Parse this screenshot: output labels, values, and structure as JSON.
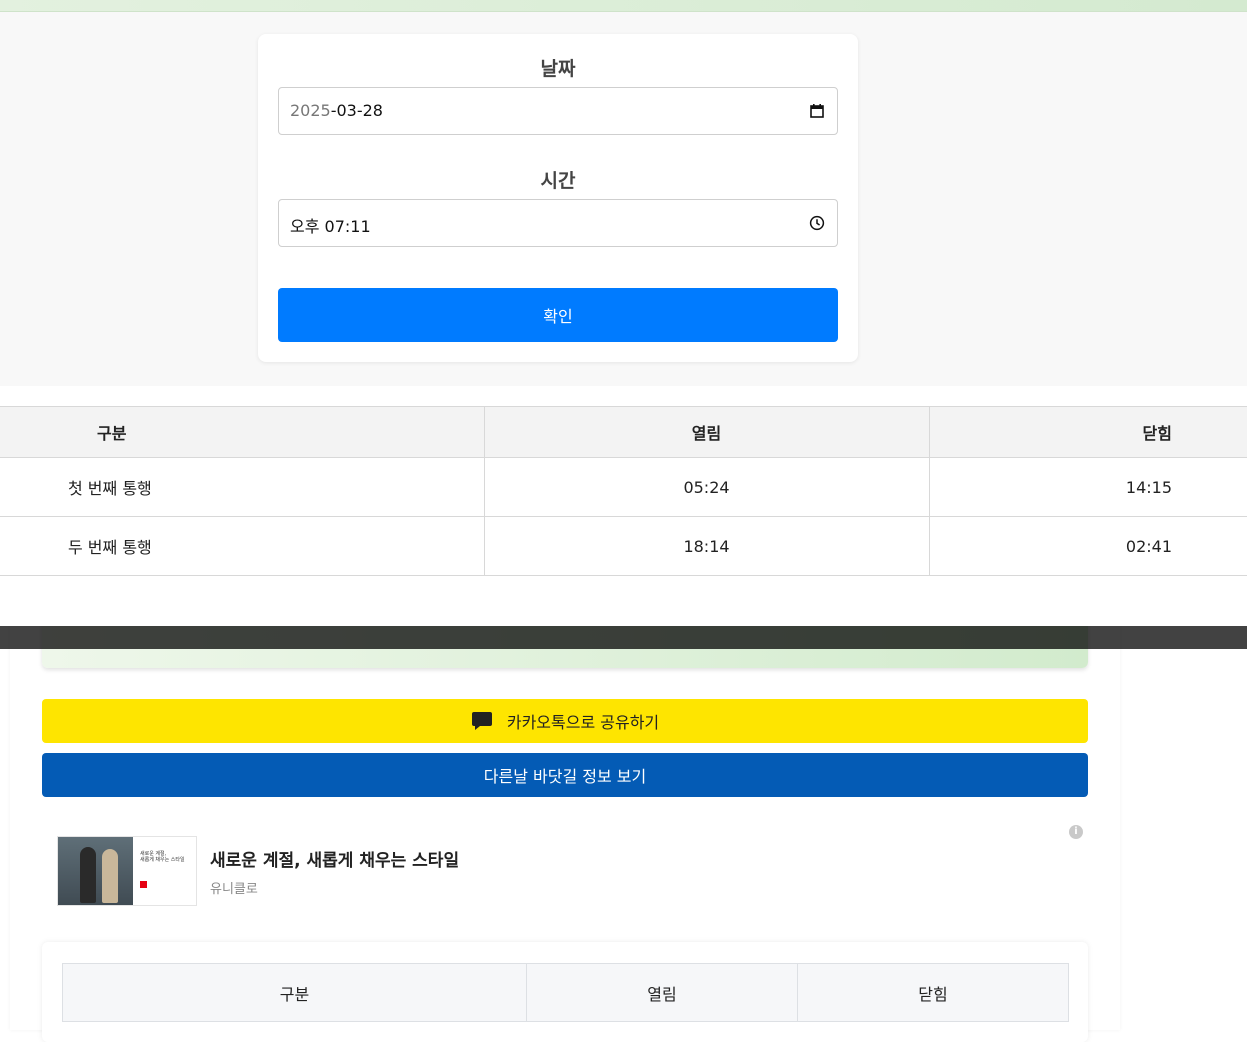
{
  "form": {
    "date_label": "날짜",
    "date_value_year": "2025",
    "date_value_rest": "-03-28",
    "time_label": "시간",
    "time_value": "오후 07:11",
    "confirm_label": "확인"
  },
  "result_table": {
    "headers": [
      "구분",
      "열림",
      "닫힘"
    ],
    "rows": [
      {
        "name": "첫 번째 통행",
        "open": "05:24",
        "close": "14:15"
      },
      {
        "name": "두 번째 통행",
        "open": "18:14",
        "close": "02:41"
      }
    ]
  },
  "background": {
    "kakao_label": "카카오톡으로 공유하기",
    "other_day_label": "다른날 바닷길 정보 보기",
    "ad": {
      "title": "새로운 계절, 새롭게 채우는 스타일",
      "brand": "유니클로",
      "mini_text": "새로운 계절,\n새롭게 채우는 스타일"
    },
    "table_headers": [
      "구분",
      "열림",
      "닫힘"
    ]
  },
  "colors": {
    "confirm_button": "#007bff",
    "kakao_button": "#fee500",
    "other_day_button": "#045bb5"
  },
  "icons": {
    "date_field": "calendar-icon",
    "time_field": "clock-icon",
    "kakao_button": "speech-bubble-icon",
    "ad": "info-icon"
  }
}
